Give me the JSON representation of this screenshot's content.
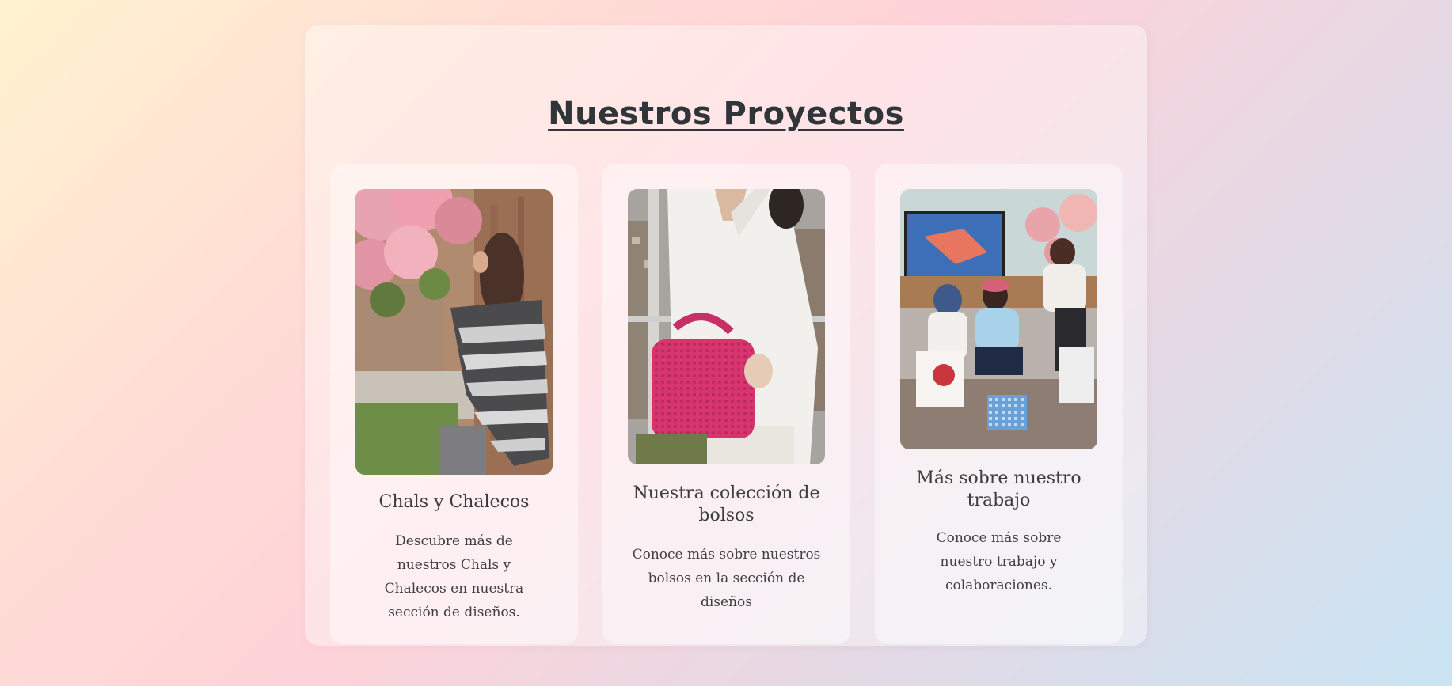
{
  "section": {
    "title": "Nuestros Proyectos"
  },
  "cards": [
    {
      "title": "Chals y Chalecos",
      "description": "Descubre más de nuestros Chals y Chalecos en nuestra sección de diseños.",
      "image": "photo-woman-wearing-striped-shawl"
    },
    {
      "title": "Nuestra colección de bolsos",
      "description": "Conoce más sobre nuestros bolsos en la sección de diseños",
      "image": "photo-pink-crochet-handbag"
    },
    {
      "title": "Más sobre nuestro trabajo",
      "description": "Conoce más sobre nuestro trabajo y colaboraciones.",
      "image": "photo-group-knitting-session"
    }
  ],
  "colors": {
    "title": "#2f3539",
    "text": "#3f3d42",
    "bag_pink": "#d8356f"
  }
}
